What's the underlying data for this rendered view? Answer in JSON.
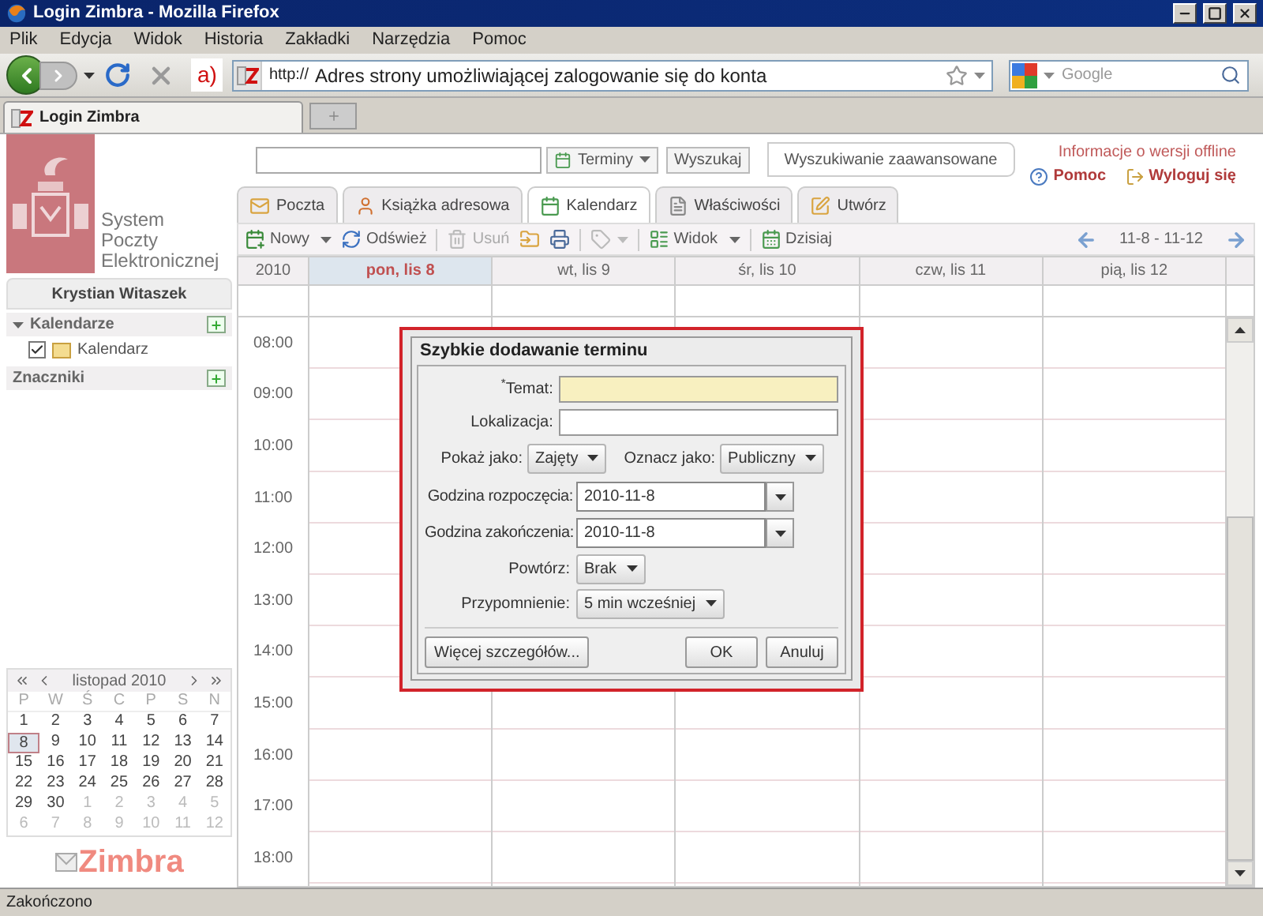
{
  "window": {
    "title": "Login Zimbra - Mozilla Firefox"
  },
  "menu": [
    "Plik",
    "Edycja",
    "Widok",
    "Historia",
    "Zakładki",
    "Narzędzia",
    "Pomoc"
  ],
  "nav": {
    "marker": "a)",
    "url_scheme": "http://",
    "url_text": "Adres strony umożliwiającej zalogowanie się do konta",
    "search_placeholder": "Google"
  },
  "browser_tabs": [
    {
      "label": "Login Zimbra",
      "selected": true
    }
  ],
  "app": {
    "logo_text": [
      "System",
      "Poczty",
      "Elektronicznej"
    ],
    "user": "Krystian Witaszek",
    "sections": [
      {
        "title": "Kalendarze",
        "items": [
          {
            "label": "Kalendarz",
            "checked": true
          }
        ]
      },
      {
        "title": "Znaczniki"
      }
    ],
    "search": {
      "scope": "Terminy",
      "button": "Wyszukaj",
      "advanced": "Wyszukiwanie zaawansowane"
    },
    "offline_info": "Informacje o wersji offline",
    "help": "Pomoc",
    "logout": "Wyloguj się",
    "tabs": [
      {
        "label": "Poczta",
        "selected": false
      },
      {
        "label": "Książka adresowa",
        "selected": false
      },
      {
        "label": "Kalendarz",
        "selected": true
      },
      {
        "label": "Właściwości",
        "selected": false
      },
      {
        "label": "Utwórz",
        "selected": false
      }
    ],
    "toolbar": [
      {
        "kind": "button",
        "label": "Nowy",
        "dropdown": true,
        "disabled": false
      },
      {
        "kind": "button",
        "label": "Odśwież",
        "dropdown": false,
        "disabled": false
      },
      {
        "kind": "separator"
      },
      {
        "kind": "button",
        "label": "Usuń",
        "dropdown": false,
        "disabled": true
      },
      {
        "kind": "icon",
        "dropdown": false,
        "disabled": false
      },
      {
        "kind": "icon",
        "dropdown": false,
        "disabled": false
      },
      {
        "kind": "separator"
      },
      {
        "kind": "icon",
        "dropdown": true,
        "disabled": true
      },
      {
        "kind": "separator"
      },
      {
        "kind": "button",
        "label": "Widok",
        "dropdown": true,
        "disabled": false
      },
      {
        "kind": "separator"
      },
      {
        "kind": "button",
        "label": "Dzisiaj",
        "dropdown": false,
        "disabled": false
      }
    ],
    "range": "11-8 - 11-12",
    "year": "2010",
    "days": [
      {
        "label": "pon, lis 8",
        "selected": true
      },
      {
        "label": "wt, lis 9",
        "selected": false
      },
      {
        "label": "śr, lis 10",
        "selected": false
      },
      {
        "label": "czw, lis 11",
        "selected": false
      },
      {
        "label": "pią, lis 12",
        "selected": false
      }
    ],
    "hours": [
      "08:00",
      "09:00",
      "10:00",
      "11:00",
      "12:00",
      "13:00",
      "14:00",
      "15:00",
      "16:00",
      "17:00",
      "18:00"
    ],
    "mini_calendar": {
      "title": "listopad 2010",
      "weekdays": [
        "P",
        "W",
        "Ś",
        "C",
        "P",
        "S",
        "N"
      ],
      "days": [
        {
          "label": "1",
          "other_month": false,
          "selected": false
        },
        {
          "label": "2",
          "other_month": false,
          "selected": false
        },
        {
          "label": "3",
          "other_month": false,
          "selected": false
        },
        {
          "label": "4",
          "other_month": false,
          "selected": false
        },
        {
          "label": "5",
          "other_month": false,
          "selected": false
        },
        {
          "label": "6",
          "other_month": false,
          "selected": false
        },
        {
          "label": "7",
          "other_month": false,
          "selected": false
        },
        {
          "label": "8",
          "other_month": false,
          "selected": true
        },
        {
          "label": "9",
          "other_month": false,
          "selected": false
        },
        {
          "label": "10",
          "other_month": false,
          "selected": false
        },
        {
          "label": "11",
          "other_month": false,
          "selected": false
        },
        {
          "label": "12",
          "other_month": false,
          "selected": false
        },
        {
          "label": "13",
          "other_month": false,
          "selected": false
        },
        {
          "label": "14",
          "other_month": false,
          "selected": false
        },
        {
          "label": "15",
          "other_month": false,
          "selected": false
        },
        {
          "label": "16",
          "other_month": false,
          "selected": false
        },
        {
          "label": "17",
          "other_month": false,
          "selected": false
        },
        {
          "label": "18",
          "other_month": false,
          "selected": false
        },
        {
          "label": "19",
          "other_month": false,
          "selected": false
        },
        {
          "label": "20",
          "other_month": false,
          "selected": false
        },
        {
          "label": "21",
          "other_month": false,
          "selected": false
        },
        {
          "label": "22",
          "other_month": false,
          "selected": false
        },
        {
          "label": "23",
          "other_month": false,
          "selected": false
        },
        {
          "label": "24",
          "other_month": false,
          "selected": false
        },
        {
          "label": "25",
          "other_month": false,
          "selected": false
        },
        {
          "label": "26",
          "other_month": false,
          "selected": false
        },
        {
          "label": "27",
          "other_month": false,
          "selected": false
        },
        {
          "label": "28",
          "other_month": false,
          "selected": false
        },
        {
          "label": "29",
          "other_month": false,
          "selected": false
        },
        {
          "label": "30",
          "other_month": false,
          "selected": false
        },
        {
          "label": "1",
          "other_month": true,
          "selected": false
        },
        {
          "label": "2",
          "other_month": true,
          "selected": false
        },
        {
          "label": "3",
          "other_month": true,
          "selected": false
        },
        {
          "label": "4",
          "other_month": true,
          "selected": false
        },
        {
          "label": "5",
          "other_month": true,
          "selected": false
        },
        {
          "label": "6",
          "other_month": true,
          "selected": false
        },
        {
          "label": "7",
          "other_month": true,
          "selected": false
        },
        {
          "label": "8",
          "other_month": true,
          "selected": false
        },
        {
          "label": "9",
          "other_month": true,
          "selected": false
        },
        {
          "label": "10",
          "other_month": true,
          "selected": false
        },
        {
          "label": "11",
          "other_month": true,
          "selected": false
        },
        {
          "label": "12",
          "other_month": true,
          "selected": false
        }
      ]
    },
    "brand": "Zimbra",
    "dialog": {
      "title": "Szybkie dodawanie terminu",
      "subject_label": "$^{*}$Temat:",
      "location_label": "Lokalizacja:",
      "show_as_label": "Pokaż jako:",
      "show_as": "Zajęty",
      "mark_as_label": "Oznacz jako:",
      "mark_as": "Publiczny",
      "start_label": "Godzina rozpoczęcia:",
      "start": "2010-11-8",
      "end_label": "Godzina zakończenia:",
      "end": "2010-11-8",
      "repeat_label": "Powtórz:",
      "repeat": "Brak",
      "reminder_label": "Przypomnienie:",
      "reminder": "5 min wcześniej",
      "more_button": "Więcej szczegółów...",
      "ok_button": "OK",
      "cancel_button": "Anuluj"
    }
  },
  "status_bar": "Zakończono"
}
